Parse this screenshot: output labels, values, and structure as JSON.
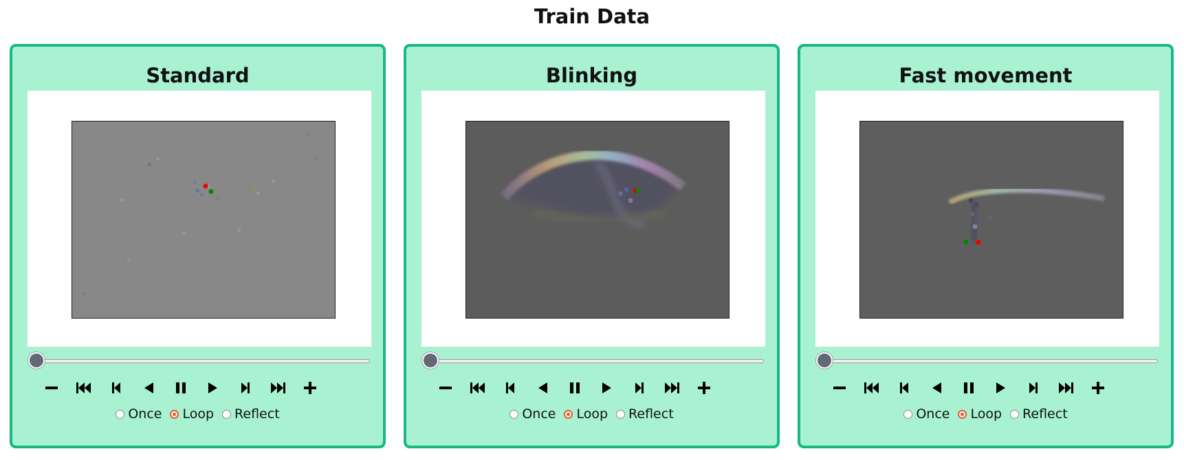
{
  "page": {
    "title": "Train Data"
  },
  "panels": [
    {
      "title": "Standard",
      "frame_bg": "#888888",
      "slider_value": 0,
      "modes": [
        {
          "label": "Once",
          "checked": false
        },
        {
          "label": "Loop",
          "checked": true
        },
        {
          "label": "Reflect",
          "checked": false
        }
      ]
    },
    {
      "title": "Blinking",
      "frame_bg": "#5c5c5c",
      "slider_value": 0,
      "modes": [
        {
          "label": "Once",
          "checked": false
        },
        {
          "label": "Loop",
          "checked": true
        },
        {
          "label": "Reflect",
          "checked": false
        }
      ]
    },
    {
      "title": "Fast movement",
      "frame_bg": "#5e5e5e",
      "slider_value": 0,
      "modes": [
        {
          "label": "Once",
          "checked": false
        },
        {
          "label": "Loop",
          "checked": true
        },
        {
          "label": "Reflect",
          "checked": false
        }
      ]
    }
  ],
  "controls": [
    {
      "name": "minus-icon",
      "label": "decrease speed"
    },
    {
      "name": "first-frame-icon",
      "label": "first frame"
    },
    {
      "name": "step-back-icon",
      "label": "previous frame"
    },
    {
      "name": "play-reverse-icon",
      "label": "play reverse"
    },
    {
      "name": "pause-icon",
      "label": "pause"
    },
    {
      "name": "play-icon",
      "label": "play"
    },
    {
      "name": "step-forward-icon",
      "label": "next frame"
    },
    {
      "name": "last-frame-icon",
      "label": "last frame"
    },
    {
      "name": "plus-icon",
      "label": "increase speed"
    }
  ],
  "colors": {
    "panel_bg": "#a8f2d2",
    "panel_border": "#17b882",
    "radio_accent": "#e8592a",
    "marker_red": "#ee0000",
    "marker_green": "#008800"
  }
}
